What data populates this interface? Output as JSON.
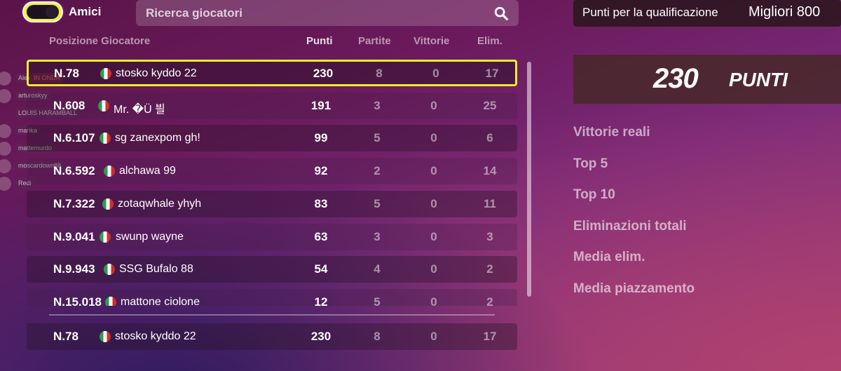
{
  "toggle": {
    "label": "Amici",
    "state": "on"
  },
  "search": {
    "placeholder": "Ricerca giocatori",
    "icon": "search-icon"
  },
  "columns": {
    "position_player": "Posizione Giocatore",
    "points": "Punti",
    "matches": "Partite",
    "wins": "Vittorie",
    "elims": "Elim."
  },
  "rows": [
    {
      "rank": "N.78",
      "name": "stosko kyddo 22",
      "points": "230",
      "matches": "8",
      "wins": "0",
      "elims": "17"
    },
    {
      "rank": "N.608",
      "name": "Mr. �Ü 븰",
      "points": "191",
      "matches": "3",
      "wins": "0",
      "elims": "25"
    },
    {
      "rank": "N.6.107",
      "name": "sg zanexpom gh!",
      "points": "99",
      "matches": "5",
      "wins": "0",
      "elims": "6"
    },
    {
      "rank": "N.6.592",
      "name": "alchawa 99",
      "points": "92",
      "matches": "2",
      "wins": "0",
      "elims": "14"
    },
    {
      "rank": "N.7.322",
      "name": "zotaqwhale yhyh",
      "points": "83",
      "matches": "5",
      "wins": "0",
      "elims": "11"
    },
    {
      "rank": "N.9.041",
      "name": "swunp wayne",
      "points": "63",
      "matches": "3",
      "wins": "0",
      "elims": "3"
    },
    {
      "rank": "N.9.943",
      "name": "SSG Bufalo 88",
      "points": "54",
      "matches": "4",
      "wins": "0",
      "elims": "2"
    },
    {
      "rank": "N.15.018",
      "name": "mattone ciolone",
      "points": "12",
      "matches": "5",
      "wins": "0",
      "elims": "2"
    }
  ],
  "my_row": {
    "rank": "N.78",
    "name": "stosko kyddo 22",
    "points": "230",
    "matches": "8",
    "wins": "0",
    "elims": "17"
  },
  "viewers": [
    {
      "name": "Alex",
      "badge": "IN ONDA"
    },
    {
      "name": "arturoskyy"
    },
    {
      "name": "LOUIS HARAMBALL"
    },
    {
      "name": "marika"
    },
    {
      "name": "mattemurdo"
    },
    {
      "name": "moscardown88"
    },
    {
      "name": "Redi"
    }
  ],
  "qualification": {
    "label": "Punti per la qualificazione",
    "value": "Migliori 800"
  },
  "score": {
    "value": "230",
    "unit": "PUNTI"
  },
  "stats": [
    "Vittorie reali",
    "Top 5",
    "Top 10",
    "Eliminazioni totali",
    "Media elim.",
    "Media piazzamento"
  ],
  "colors": {
    "highlight": "#f4ee2c",
    "toggle": "#f7ef3a"
  }
}
